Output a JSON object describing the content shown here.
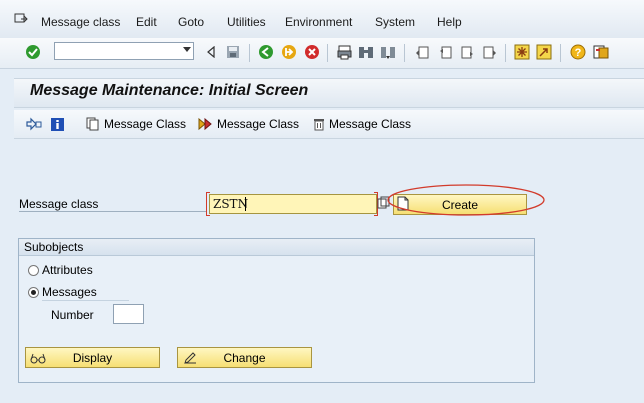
{
  "menu": {
    "items": [
      "Message class",
      "Edit",
      "Goto",
      "Utilities",
      "Environment",
      "System",
      "Help"
    ]
  },
  "toolbar": {
    "command_field_value": "",
    "icons": [
      "checkmark-icon",
      "back-arrow-icon",
      "save-icon",
      "back-icon",
      "exit-icon",
      "cancel-icon",
      "print-icon",
      "find-icon",
      "find-next-icon",
      "first-page-icon",
      "previous-page-icon",
      "next-page-icon",
      "last-page-icon",
      "create-session-icon",
      "shortcut-icon",
      "help-icon",
      "layout-menu-icon"
    ]
  },
  "page": {
    "title": "Message Maintenance: Initial Screen"
  },
  "app_toolbar": {
    "buttons": [
      "Message Class",
      "Message Class",
      "Message Class"
    ]
  },
  "form": {
    "message_class_label": "Message class",
    "message_class_value": "ZSTN",
    "create_label": "Create"
  },
  "subobjects": {
    "title": "Subobjects",
    "attributes_label": "Attributes",
    "messages_label": "Messages",
    "selected": "Messages",
    "number_label": "Number",
    "number_value": "",
    "display_label": "Display",
    "change_label": "Change"
  },
  "colors": {
    "background": "#e4edf6",
    "button_yellow": "#f6df74",
    "highlight_red": "#d23b2b",
    "ok_green": "#2f9a2f"
  }
}
